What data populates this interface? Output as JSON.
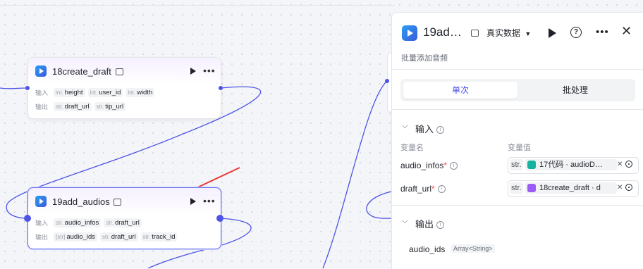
{
  "canvas": {
    "nodes": [
      {
        "title": "18create_draft",
        "input_label": "输入",
        "output_label": "输出",
        "inputs": [
          {
            "type": "int.",
            "name": "height"
          },
          {
            "type": "int.",
            "name": "user_id"
          },
          {
            "type": "int.",
            "name": "width"
          }
        ],
        "outputs": [
          {
            "type": "str.",
            "name": "draft_url"
          },
          {
            "type": "str.",
            "name": "tip_url"
          }
        ]
      },
      {
        "title": "19add_audios",
        "input_label": "输入",
        "output_label": "输出",
        "inputs": [
          {
            "type": "str.",
            "name": "audio_infos"
          },
          {
            "type": "str.",
            "name": "draft_url"
          }
        ],
        "outputs": [
          {
            "type": "[str]",
            "name": "audio_ids"
          },
          {
            "type": "str.",
            "name": "draft_url"
          },
          {
            "type": "str.",
            "name": "track_id"
          }
        ]
      }
    ],
    "colors": {
      "wire": "#4d53e8",
      "arrow": "#e53935",
      "accent": "#4d53e8"
    }
  },
  "panel": {
    "title": "19ad…",
    "data_mode": "真实数据",
    "description": "批量添加音频",
    "tabs": [
      "单次",
      "批处理"
    ],
    "active_tab": 0,
    "input_section": "输入",
    "output_section": "输出",
    "col_var_name": "变量名",
    "col_var_value": "变量值",
    "params": [
      {
        "name": "audio_infos",
        "required": "*",
        "type": "str.",
        "ref": "17代码 · audioD…",
        "ref_icon": "code-icon",
        "ref_color": "#16b3a0"
      },
      {
        "name": "draft_url",
        "required": "*",
        "type": "str.",
        "ref": "18create_draft · d",
        "ref_icon": "plugin-icon",
        "ref_color": "#9b5cf6"
      }
    ],
    "outputs": [
      {
        "name": "audio_ids",
        "type": "Array<String>"
      }
    ]
  }
}
